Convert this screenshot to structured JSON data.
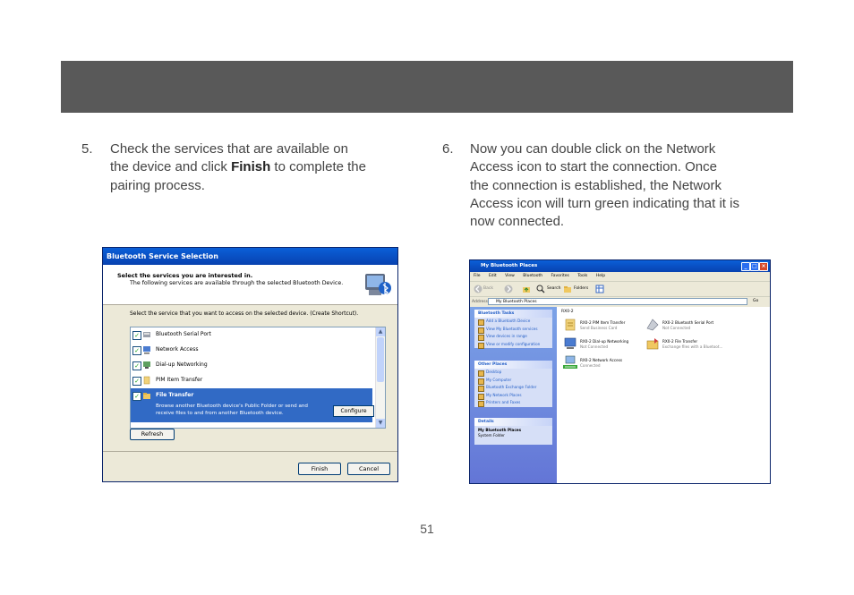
{
  "steps": {
    "s5": {
      "num": "5.",
      "line1": "Check the services that are available on",
      "line2_pre": "the device and click ",
      "line2_bold": "Finish",
      "line2_post": " to complete the",
      "line3": "pairing process."
    },
    "s6": {
      "num": "6.",
      "lines": [
        "Now you can double click on the Network",
        "Access icon to start the connection.  Once",
        "the connection is established, the Network",
        "Access icon will turn green indicating that it is",
        "now connected."
      ]
    }
  },
  "page_number": "51",
  "dialog": {
    "title": "Bluetooth Service Selection",
    "header_title": "Select the services you are interested in.",
    "header_sub": "The following services are available through the selected Bluetooth Device.",
    "instruction": "Select the service that you want to access on the selected device. (Create Shortcut).",
    "services": [
      {
        "label": "Bluetooth Serial Port",
        "checked": true
      },
      {
        "label": "Network Access",
        "checked": true
      },
      {
        "label": "Dial-up Networking",
        "checked": true
      },
      {
        "label": "PIM Item Transfer",
        "checked": true
      },
      {
        "label": "File Transfer",
        "checked": true,
        "selected": true
      }
    ],
    "selected_desc_1": "Browse another Bluetooth device's Public Folder or send and",
    "selected_desc_2": "receive files to and from another Bluetooth device.",
    "configure_label": "Configure",
    "refresh_label": "Refresh",
    "finish_label": "Finish",
    "cancel_label": "Cancel",
    "check_glyph": "✓"
  },
  "explorer": {
    "title": "My Bluetooth Places",
    "menu": [
      "File",
      "Edit",
      "View",
      "Bluetooth",
      "Favorites",
      "Tools",
      "Help"
    ],
    "toolbar": {
      "back": "Back",
      "search": "Search",
      "folders": "Folders"
    },
    "address_label": "Address",
    "address_value": "My Bluetooth Places",
    "go_label": "Go",
    "tasks": {
      "title": "Bluetooth Tasks",
      "items": [
        "Add a Bluetooth Device",
        "View My Bluetooth services",
        "View devices in range",
        "View or modify configuration"
      ]
    },
    "other": {
      "title": "Other Places",
      "items": [
        "Desktop",
        "My Computer",
        "Bluetooth Exchange Folder",
        "My Network Places",
        "Printers and Faxes"
      ]
    },
    "details": {
      "title": "Details",
      "name": "My Bluetooth Places",
      "type": "System Folder"
    },
    "group_label": "RX0-2",
    "items": [
      {
        "name": "RX0-2 PIM Item Transfer",
        "status": "Send Business Card"
      },
      {
        "name": "RX0-2 Bluetooth Serial Port",
        "status": "Not Connected"
      },
      {
        "name": "RX0-2 Dial-up Networking",
        "status": "Not Connected"
      },
      {
        "name": "RX0-2 File Transfer",
        "status": "Exchange files with a Bluetoot..."
      },
      {
        "name": "RX0-2 Network Access",
        "status": "Connected"
      }
    ],
    "window_buttons": {
      "min": "_",
      "max": "□",
      "close": "×"
    }
  }
}
